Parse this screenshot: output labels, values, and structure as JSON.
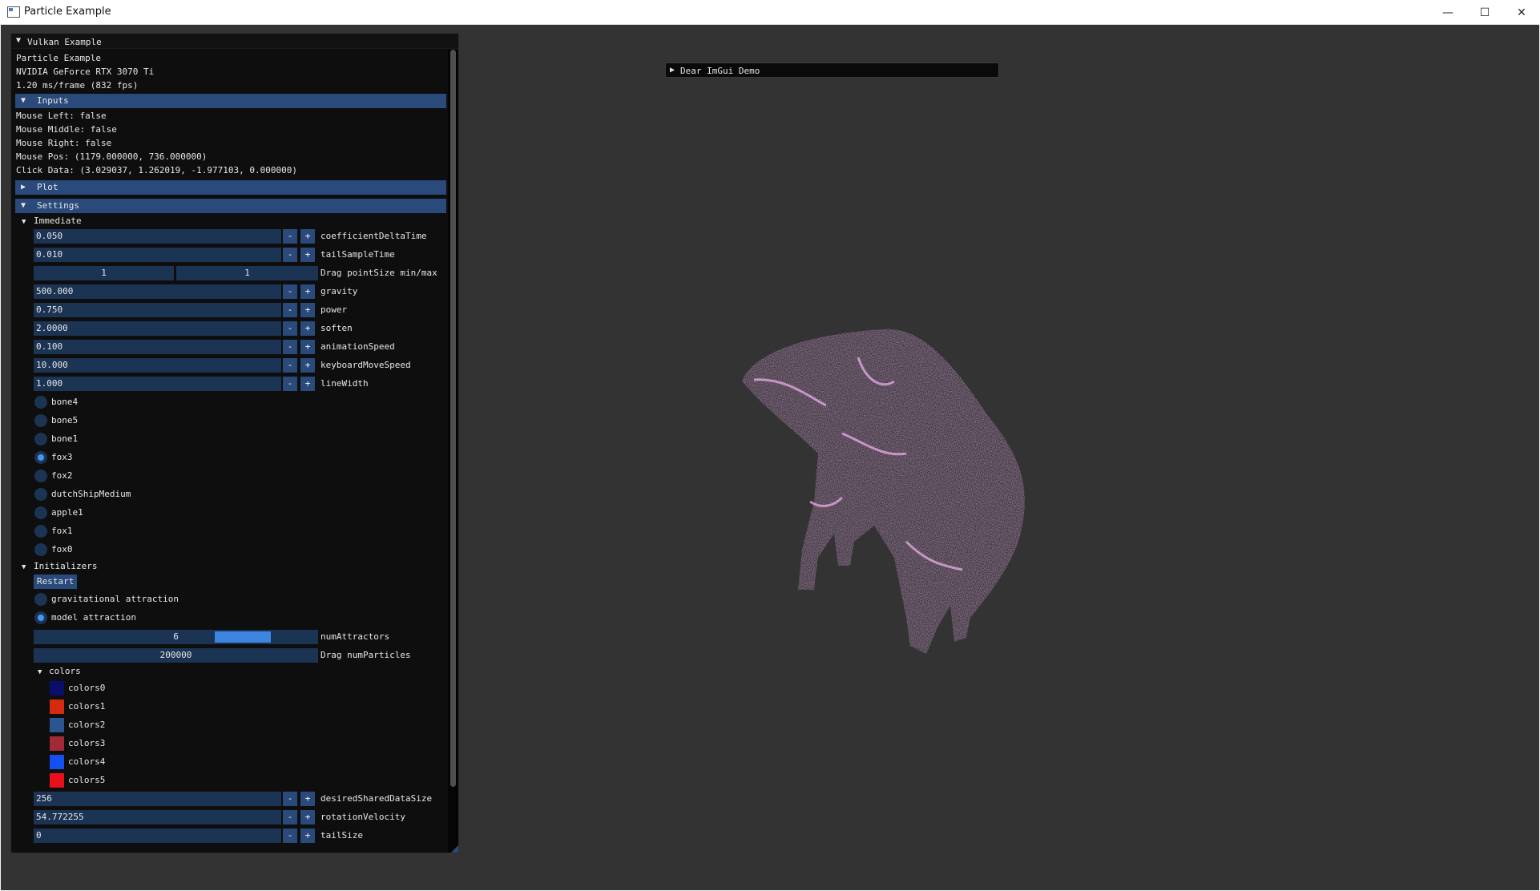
{
  "window": {
    "title": "Particle Example",
    "controls": {
      "minimize": "—",
      "maximize": "☐",
      "close": "✕"
    }
  },
  "imgui": {
    "title": "Vulkan Example",
    "app_name": "Particle Example",
    "gpu": "NVIDIA GeForce RTX 3070 Ti",
    "frame_time": "1.20 ms/frame (832 fps)",
    "inputs": {
      "header": "Inputs",
      "mouse_left": "Mouse Left: false",
      "mouse_middle": "Mouse Middle: false",
      "mouse_right": "Mouse Right: false",
      "mouse_pos": "Mouse Pos: (1179.000000, 736.000000)",
      "click_data": "Click Data: (3.029037, 1.262019, -1.977103, 0.000000)"
    },
    "plot": {
      "header": "Plot"
    },
    "settings": {
      "header": "Settings",
      "immediate": {
        "label": "Immediate",
        "coefficientDeltaTime": {
          "value": "0.050",
          "label": "coefficientDeltaTime"
        },
        "tailSampleTime": {
          "value": "0.010",
          "label": "tailSampleTime"
        },
        "pointSize": {
          "min": "1",
          "max": "1",
          "label": "Drag pointSize min/max"
        },
        "gravity": {
          "value": "500.000",
          "label": "gravity"
        },
        "power": {
          "value": "0.750",
          "label": "power"
        },
        "soften": {
          "value": "2.0000",
          "label": "soften"
        },
        "animationSpeed": {
          "value": "0.100",
          "label": "animationSpeed"
        },
        "keyboardMoveSpeed": {
          "value": "10.000",
          "label": "keyboardMoveSpeed"
        },
        "lineWidth": {
          "value": "1.000",
          "label": "lineWidth"
        },
        "models": [
          {
            "name": "bone4",
            "selected": false
          },
          {
            "name": "bone5",
            "selected": false
          },
          {
            "name": "bone1",
            "selected": false
          },
          {
            "name": "fox3",
            "selected": true
          },
          {
            "name": "fox2",
            "selected": false
          },
          {
            "name": "dutchShipMedium",
            "selected": false
          },
          {
            "name": "apple1",
            "selected": false
          },
          {
            "name": "fox1",
            "selected": false
          },
          {
            "name": "fox0",
            "selected": false
          }
        ]
      },
      "initializers": {
        "label": "Initializers",
        "restart": "Restart",
        "gravitational": "gravitational attraction",
        "model": "model attraction",
        "numAttractors": {
          "value": "6",
          "label": "numAttractors",
          "fraction": 0.79
        },
        "numParticles": {
          "value": "200000",
          "label": "Drag numParticles"
        },
        "colors": {
          "label": "colors",
          "items": [
            {
              "name": "colors0",
              "color": "#0b0d6b"
            },
            {
              "name": "colors1",
              "color": "#d42a0f"
            },
            {
              "name": "colors2",
              "color": "#2a5591"
            },
            {
              "name": "colors3",
              "color": "#a02a35"
            },
            {
              "name": "colors4",
              "color": "#1450f0"
            },
            {
              "name": "colors5",
              "color": "#e8101a"
            }
          ]
        },
        "desiredSharedDataSize": {
          "value": "256",
          "label": "desiredSharedDataSize"
        },
        "rotationVelocity": {
          "value": "54.772255",
          "label": "rotationVelocity"
        },
        "tailSize": {
          "value": "0",
          "label": "tailSize"
        }
      }
    },
    "stepper": {
      "minus": "-",
      "plus": "+"
    }
  },
  "demo_window": {
    "title": "Dear ImGui Demo"
  },
  "colors": {
    "background": "#333333",
    "panel": "#0e0e0e",
    "header": "#294a7a",
    "frame": "#1c3454",
    "accent": "#4296fa",
    "particles": "#e070e0"
  }
}
